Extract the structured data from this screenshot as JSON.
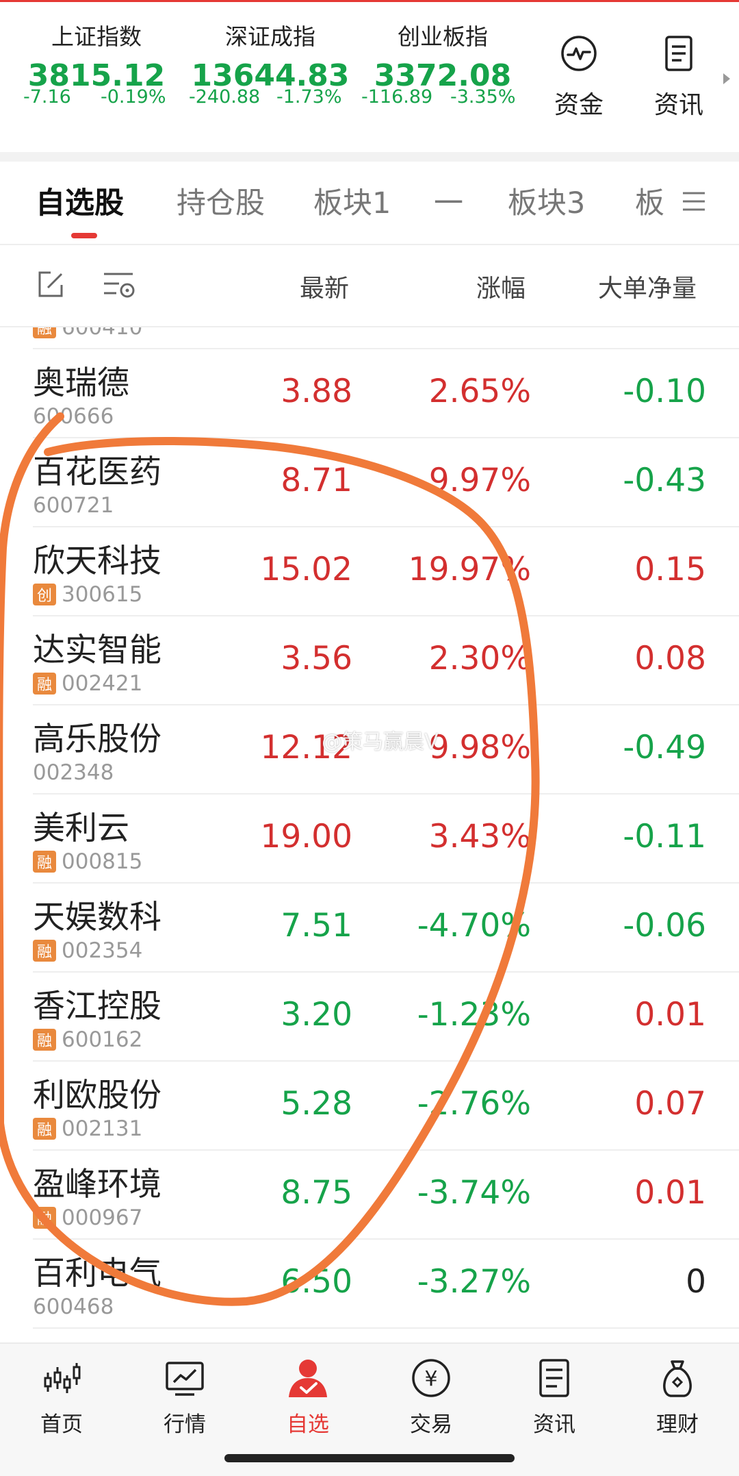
{
  "indices": [
    {
      "name": "上证指数",
      "value": "3815.12",
      "change": "-7.16",
      "pct": "-0.19%"
    },
    {
      "name": "深证成指",
      "value": "13644.83",
      "change": "-240.88",
      "pct": "-1.73%"
    },
    {
      "name": "创业板指",
      "value": "3372.08",
      "change": "-116.89",
      "pct": "-3.35%"
    }
  ],
  "quick_buttons": [
    {
      "label": "资金",
      "icon": "pulse-circle-icon"
    },
    {
      "label": "资讯",
      "icon": "document-icon"
    }
  ],
  "tabs": [
    "自选股",
    "持仓股",
    "板块1",
    "一",
    "板块3",
    "板"
  ],
  "active_tab": "自选股",
  "columns": {
    "latest": "最新",
    "change": "涨幅",
    "net": "大单净量"
  },
  "partial_top_code": "600410",
  "rows": [
    {
      "name": "奥瑞德",
      "code": "600666",
      "badge": "",
      "price": "3.88",
      "pct": "2.65%",
      "net": "-0.10",
      "price_dir": "up",
      "net_dir": "down"
    },
    {
      "name": "百花医药",
      "code": "600721",
      "badge": "",
      "price": "8.71",
      "pct": "9.97%",
      "net": "-0.43",
      "price_dir": "up",
      "net_dir": "down"
    },
    {
      "name": "欣天科技",
      "code": "300615",
      "badge": "创",
      "price": "15.02",
      "pct": "19.97%",
      "net": "0.15",
      "price_dir": "up",
      "net_dir": "up"
    },
    {
      "name": "达实智能",
      "code": "002421",
      "badge": "融",
      "price": "3.56",
      "pct": "2.30%",
      "net": "0.08",
      "price_dir": "up",
      "net_dir": "up"
    },
    {
      "name": "高乐股份",
      "code": "002348",
      "badge": "",
      "price": "12.12",
      "pct": "9.98%",
      "net": "-0.49",
      "price_dir": "up",
      "net_dir": "down"
    },
    {
      "name": "美利云",
      "code": "000815",
      "badge": "融",
      "price": "19.00",
      "pct": "3.43%",
      "net": "-0.11",
      "price_dir": "up",
      "net_dir": "down"
    },
    {
      "name": "天娱数科",
      "code": "002354",
      "badge": "融",
      "price": "7.51",
      "pct": "-4.70%",
      "net": "-0.06",
      "price_dir": "down",
      "net_dir": "down"
    },
    {
      "name": "香江控股",
      "code": "600162",
      "badge": "融",
      "price": "3.20",
      "pct": "-1.23%",
      "net": "0.01",
      "price_dir": "down",
      "net_dir": "up"
    },
    {
      "name": "利欧股份",
      "code": "002131",
      "badge": "融",
      "price": "5.28",
      "pct": "-2.76%",
      "net": "0.07",
      "price_dir": "down",
      "net_dir": "up"
    },
    {
      "name": "盈峰环境",
      "code": "000967",
      "badge": "融",
      "price": "8.75",
      "pct": "-3.74%",
      "net": "0.01",
      "price_dir": "down",
      "net_dir": "up"
    },
    {
      "name": "百利电气",
      "code": "600468",
      "badge": "",
      "price": "6.50",
      "pct": "-3.27%",
      "net": "0",
      "price_dir": "down",
      "net_dir": "flat"
    }
  ],
  "watermark": "@策马赢晨V",
  "nav": [
    {
      "label": "首页",
      "icon": "candlestick-icon"
    },
    {
      "label": "行情",
      "icon": "chart-icon"
    },
    {
      "label": "自选",
      "icon": "user-check-icon"
    },
    {
      "label": "交易",
      "icon": "yen-icon"
    },
    {
      "label": "资讯",
      "icon": "document-icon"
    },
    {
      "label": "理财",
      "icon": "money-bag-icon"
    }
  ],
  "active_nav": "自选",
  "colors": {
    "up": "#d32f2f",
    "down": "#16a34a",
    "accent": "#e53935",
    "badge": "#e9893d",
    "annotation": "#f07a3a"
  }
}
